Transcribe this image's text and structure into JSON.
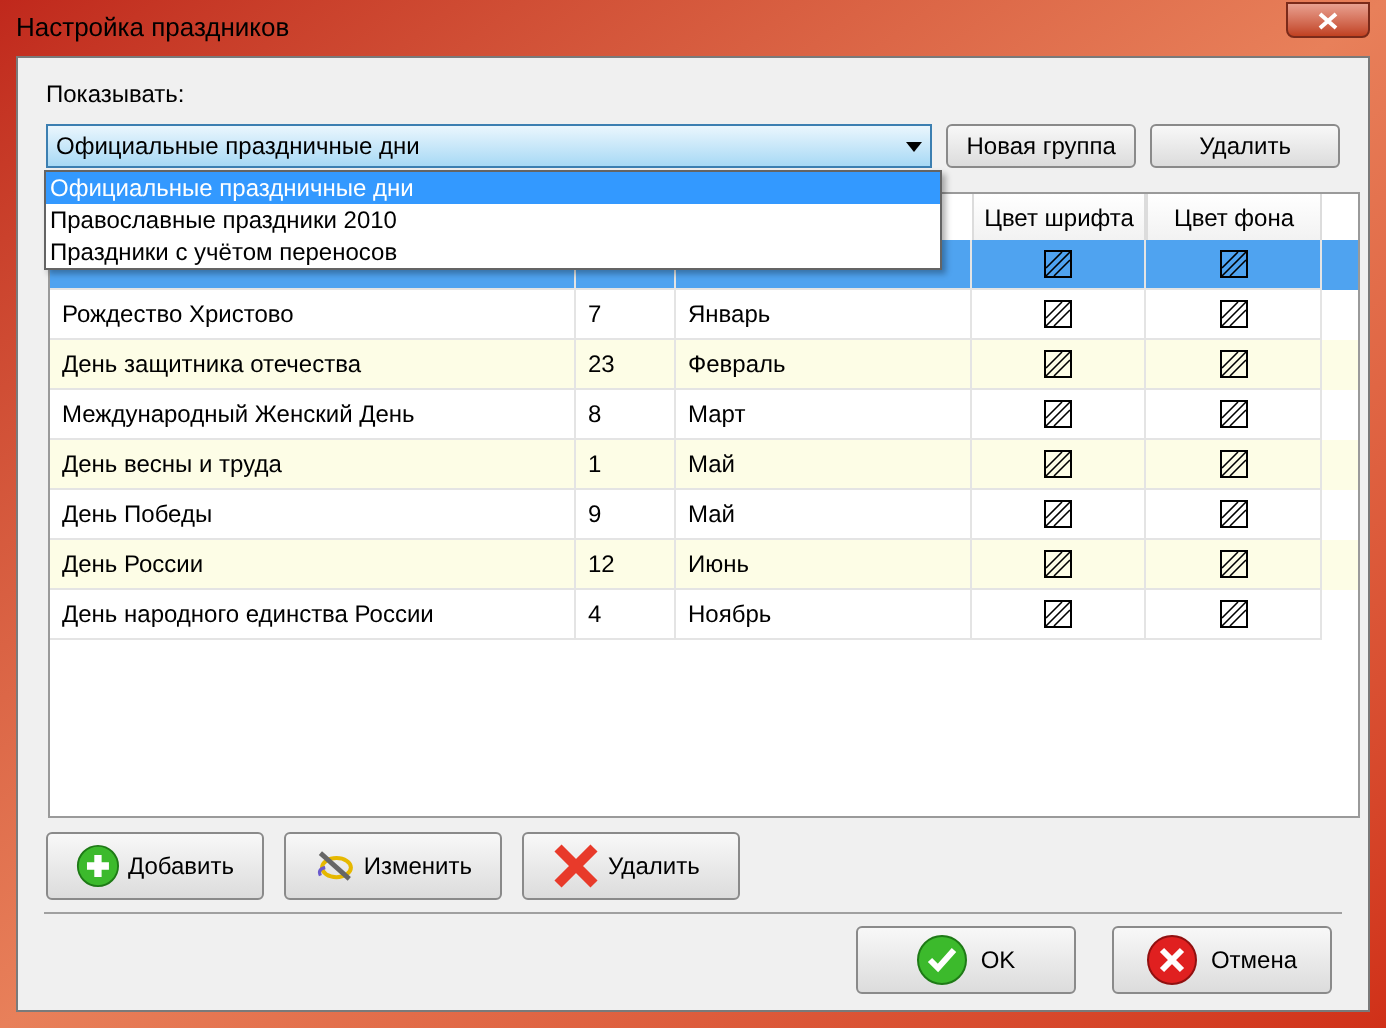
{
  "window": {
    "title": "Настройка праздников"
  },
  "show_label": "Показывать:",
  "combo": {
    "value": "Официальные праздничные дни",
    "expanded": true,
    "options": [
      {
        "label": "Официальные праздничные дни",
        "selected": true
      },
      {
        "label": "Православные праздники 2010",
        "selected": false
      },
      {
        "label": "Праздники с учётом переносов",
        "selected": false
      }
    ]
  },
  "top_buttons": [
    "Новая группа",
    "Удалить"
  ],
  "table": {
    "columns": [
      "Цвет шрифта",
      "Цвет фона"
    ],
    "rows": [
      {
        "selected": true
      },
      {
        "name": "Рождество Христово",
        "day": "7",
        "month": "Январь",
        "selected": false
      },
      {
        "name": "День защитника отечества",
        "day": "23",
        "month": "Февраль",
        "selected": false
      },
      {
        "name": "Международный Женский День",
        "day": "8",
        "month": "Март",
        "selected": false
      },
      {
        "name": "День весны и труда",
        "day": "1",
        "month": "Май",
        "selected": false
      },
      {
        "name": "День Победы",
        "day": "9",
        "month": "Май",
        "selected": false
      },
      {
        "name": "День России",
        "day": "12",
        "month": "Июнь",
        "selected": false
      },
      {
        "name": "День народного единства России",
        "day": "4",
        "month": "Ноябрь",
        "selected": false
      }
    ]
  },
  "edit_buttons": [
    {
      "kind": "add",
      "label": "Добавить"
    },
    {
      "kind": "edit",
      "label": "Изменить"
    },
    {
      "kind": "delete",
      "label": "Удалить"
    }
  ],
  "dialog_buttons": [
    {
      "kind": "ok",
      "label": "OK"
    },
    {
      "kind": "cancel",
      "label": "Отмена"
    }
  ]
}
